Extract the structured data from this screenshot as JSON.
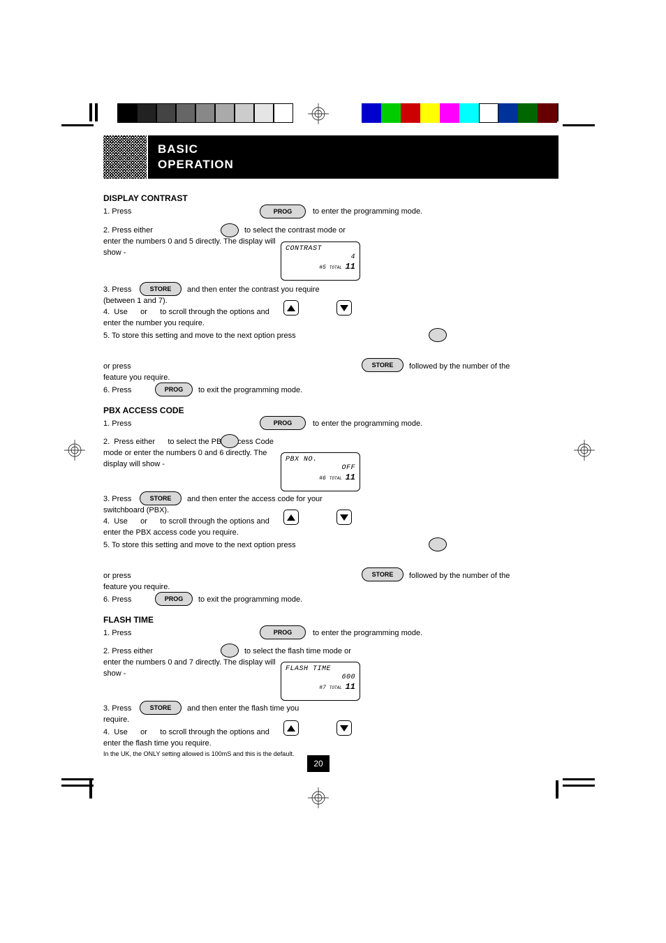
{
  "header": {
    "title_line1": "BASIC",
    "title_line2": "OPERATION",
    "noise_label": ""
  },
  "contrast": {
    "title": "DISPLAY CONTRAST",
    "s1_prefix": "1.  Press ",
    "s1_btn": "PROG",
    "s1_suffix": " to enter the programming mode.",
    "s2_prefix": "2.  Press either ",
    "s2_mid": " to select the contrast mode or",
    "s2_cont1": "    enter the numbers 0 and 5 directly. The display will",
    "s2_cont2": "    show -",
    "lcd_l1": "CONTRAST",
    "lcd_l2": "4",
    "lcd_hash": "#",
    "lcd_n": "5",
    "lcd_total_lbl": "TOTAL",
    "lcd_total": "11",
    "s3_prefix": "3.  Press ",
    "s3_btn": "STORE",
    "s3_suffix": " and then enter the contrast you require",
    "s3_cont": "     (between 1 and 7).",
    "s4_prefix": "4.  Use      or      to scroll through the options and",
    "s4_cont1": "     enter the number you require.",
    "s5_prefix": "5.  To store this setting and move to the next option press ",
    "s5a": "     or press ",
    "s5a_btn": "STORE",
    "s5a_suffix": " followed by the number of the",
    "s5b": "     feature you require.",
    "s6_prefix": "6.  Press ",
    "s6_btn": "PROG",
    "s6_suffix": " to exit the programming mode."
  },
  "pbx": {
    "title": "PBX ACCESS CODE",
    "s1_prefix": "1.  Press ",
    "s1_btn": "PROG",
    "s1_suffix": " to enter the programming mode.",
    "s2_prefix": "2.  Press either      to select the PBX Access Code",
    "s2_cont1": "    mode or enter the numbers 0 and 6 directly. The",
    "s2_cont2": "    display will show -",
    "lcd_l1": "PBX NO.",
    "lcd_l2": "OFF",
    "lcd_hash": "#",
    "lcd_n": "6",
    "lcd_total_lbl": "TOTAL",
    "lcd_total": "11",
    "s3_prefix": "3.  Press ",
    "s3_btn": "STORE",
    "s3_suffix": " and then enter the access code for your",
    "s3_cont": "     switchboard (PBX).",
    "s4_prefix": "4.  Use      or      to scroll through the options and",
    "s4_cont1": "     enter the PBX access code you require.",
    "s5_prefix": "5.  To store this setting and move to the next option press ",
    "s5a": "     or press ",
    "s5a_btn": "STORE",
    "s5a_suffix": " followed by the number of the",
    "s5b": "     feature you require.",
    "s6_prefix": "6.  Press ",
    "s6_btn": "PROG",
    "s6_suffix": " to exit the programming mode."
  },
  "flash": {
    "title": "FLASH TIME",
    "s1_prefix": "1.  Press ",
    "s1_btn": "PROG",
    "s1_suffix": " to enter the programming mode.",
    "s2_prefix": "2.  Press either ",
    "s2_mid": " to select the flash time mode or",
    "s2_cont1": "    enter the numbers 0 and 7 directly. The display will",
    "s2_cont2": "    show -",
    "lcd_l1": "FLASH TIME",
    "lcd_l2": "600",
    "lcd_hash": "#",
    "lcd_n": "7",
    "lcd_total_lbl": "TOTAL",
    "lcd_total": "11",
    "s3_prefix": "3.  Press ",
    "s3_btn": "STORE",
    "s3_suffix": " and then enter the flash time you",
    "s3_cont": "     require.",
    "s4_prefix": "4.  Use      or      to scroll through the options and",
    "s4_cont1": "     enter the flash time you require.",
    "footnote": "In the UK, the ONLY setting allowed is 100mS and this is the default."
  },
  "page_number": "20"
}
